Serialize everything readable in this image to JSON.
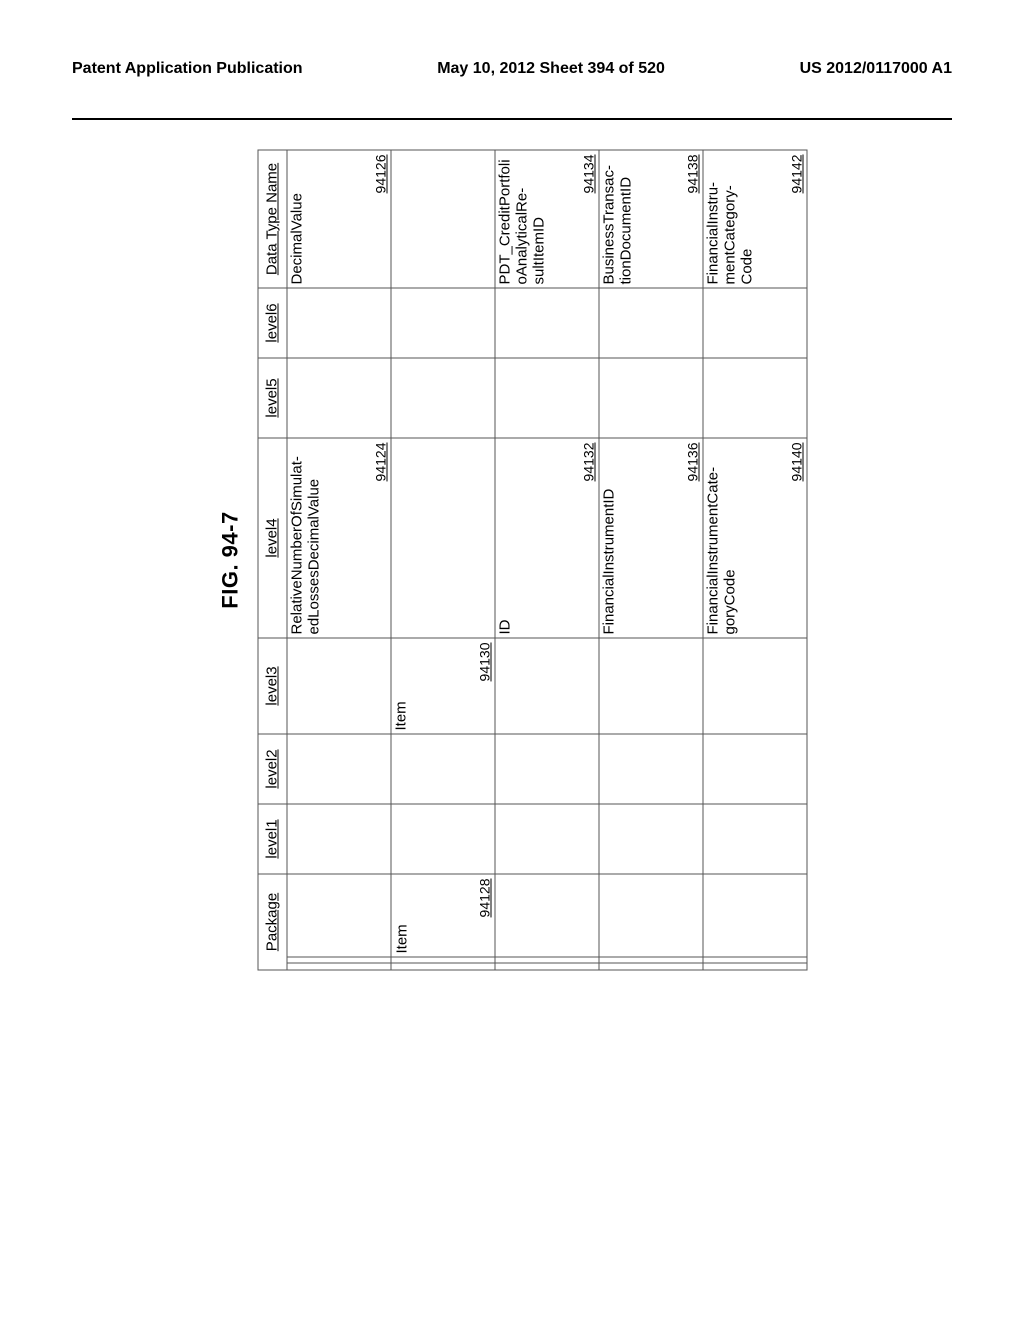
{
  "header": {
    "left": "Patent Application Publication",
    "center": "May 10, 2012  Sheet 394 of 520",
    "right": "US 2012/0117000 A1"
  },
  "figure": {
    "label": "FIG. 94-7"
  },
  "columns": {
    "package": "Package",
    "l1": "level1",
    "l2": "level2",
    "l3": "level3",
    "l4": "level4",
    "l5": "level5",
    "l6": "level6",
    "dt": "Data Type Name"
  },
  "rows": [
    {
      "package": {
        "text": "",
        "ref": ""
      },
      "l3": {
        "text": "",
        "ref": ""
      },
      "l4": {
        "text": "RelativeNumberOfSimulat-edLossesDecimalValue",
        "ref": "94124"
      },
      "dt": {
        "text": "DecimalValue",
        "ref": "94126"
      }
    },
    {
      "package": {
        "text": "Item",
        "ref": "94128"
      },
      "l3": {
        "text": "Item",
        "ref": "94130"
      },
      "l4": {
        "text": "",
        "ref": ""
      },
      "dt": {
        "text": "",
        "ref": ""
      }
    },
    {
      "package": {
        "text": "",
        "ref": ""
      },
      "l3": {
        "text": "",
        "ref": ""
      },
      "l4": {
        "text": "ID",
        "ref": "94132"
      },
      "dt": {
        "text": "PDT_CreditPortfolioAnalyticalRe-sultItemID",
        "ref": "94134"
      }
    },
    {
      "package": {
        "text": "",
        "ref": ""
      },
      "l3": {
        "text": "",
        "ref": ""
      },
      "l4": {
        "text": "FinancialInstrumentID",
        "ref": "94136"
      },
      "dt": {
        "text": "BusinessTransac-tionDocumentID",
        "ref": "94138"
      }
    },
    {
      "package": {
        "text": "",
        "ref": ""
      },
      "l3": {
        "text": "",
        "ref": ""
      },
      "l4": {
        "text": "FinancialInstrumentCate-goryCode",
        "ref": "94140"
      },
      "dt": {
        "text": "FinancialInstru-mentCategory-Code",
        "ref": "94142"
      }
    }
  ]
}
